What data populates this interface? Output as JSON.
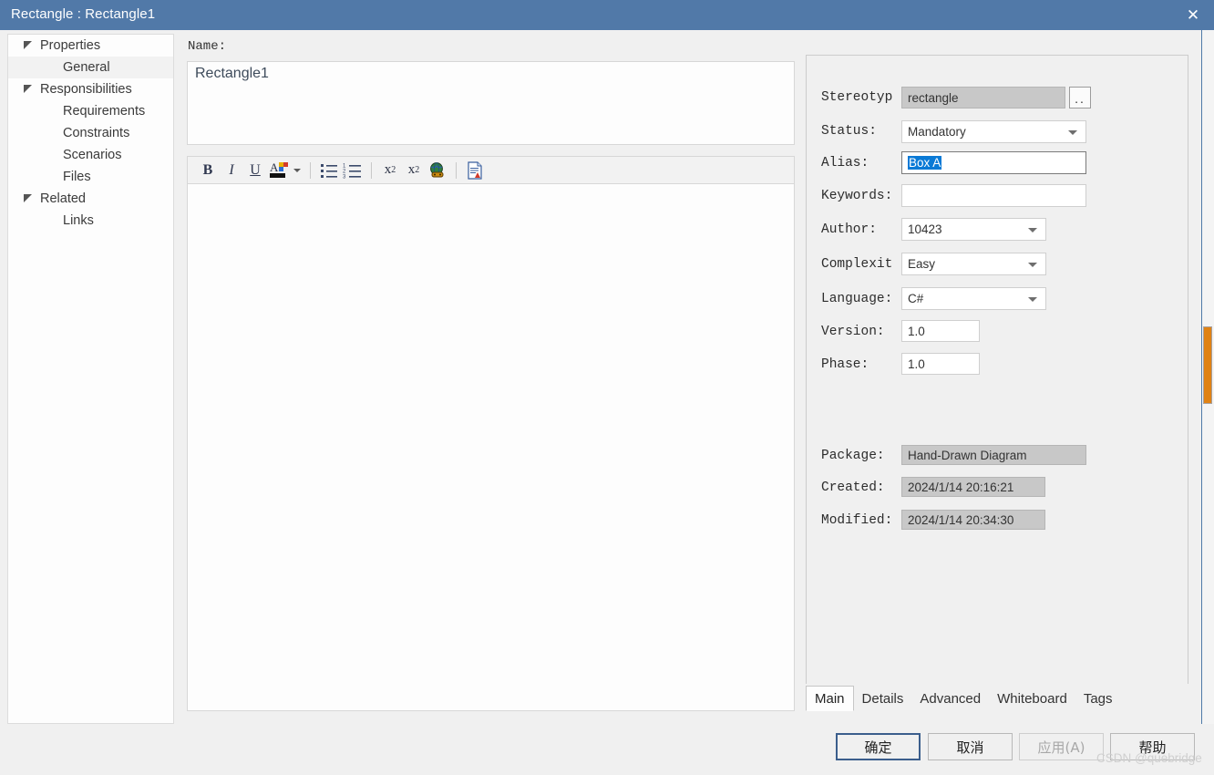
{
  "window": {
    "title": "Rectangle : Rectangle1",
    "close_icon": "close-icon"
  },
  "sidebar": {
    "items": [
      {
        "label": "Properties",
        "type": "node",
        "selected": false
      },
      {
        "label": "General",
        "type": "leaf",
        "selected": true
      },
      {
        "label": "Responsibilities",
        "type": "node",
        "selected": false
      },
      {
        "label": "Requirements",
        "type": "leaf",
        "selected": false
      },
      {
        "label": "Constraints",
        "type": "leaf",
        "selected": false
      },
      {
        "label": "Scenarios",
        "type": "leaf",
        "selected": false
      },
      {
        "label": "Files",
        "type": "leaf",
        "selected": false
      },
      {
        "label": "Related",
        "type": "node",
        "selected": false
      },
      {
        "label": "Links",
        "type": "leaf",
        "selected": false
      }
    ]
  },
  "name_section": {
    "label": "Name:",
    "value": "Rectangle1"
  },
  "toolbar": {
    "bold": "B",
    "italic": "I",
    "underline": "U",
    "font_color": "A",
    "bullet_list": "bullet-list-icon",
    "numbered_list": "numbered-list-icon",
    "superscript_base": "x",
    "superscript_exp": "2",
    "subscript_base": "x",
    "subscript_exp": "2",
    "hyperlink": "globe-hyperlink-icon",
    "insert_document": "insert-document-icon"
  },
  "properties": {
    "stereotype": {
      "label": "Stereotyp",
      "value": "rectangle",
      "readonly": true,
      "browse_button": ".."
    },
    "status": {
      "label": "Status:",
      "value": "Mandatory"
    },
    "alias": {
      "label": "Alias:",
      "value": "Box A",
      "selected": true
    },
    "keywords": {
      "label": "Keywords:",
      "value": ""
    },
    "author": {
      "label": "Author:",
      "value": "10423"
    },
    "complexity": {
      "label": "Complexit",
      "value": "Easy"
    },
    "language": {
      "label": "Language:",
      "value": "C#"
    },
    "version": {
      "label": "Version:",
      "value": "1.0"
    },
    "phase": {
      "label": "Phase:",
      "value": "1.0"
    },
    "package": {
      "label": "Package:",
      "value": "Hand-Drawn Diagram",
      "readonly": true
    },
    "created": {
      "label": "Created:",
      "value": "2024/1/14 20:16:21",
      "readonly": true
    },
    "modified": {
      "label": "Modified:",
      "value": "2024/1/14 20:34:30",
      "readonly": true
    }
  },
  "tabs": [
    {
      "label": "Main",
      "active": true
    },
    {
      "label": "Details",
      "active": false
    },
    {
      "label": "Advanced",
      "active": false
    },
    {
      "label": "Whiteboard",
      "active": false
    },
    {
      "label": "Tags",
      "active": false
    }
  ],
  "buttons": {
    "ok": "确定",
    "cancel": "取消",
    "apply": "应用(A)",
    "help": "帮助"
  },
  "watermark": "CSDN @quebridge",
  "colors": {
    "titlebar": "#5179a8",
    "selection": "#0a7ad6",
    "scroll_thumb": "#e08214",
    "dialog_bg": "#f0f0f0"
  }
}
